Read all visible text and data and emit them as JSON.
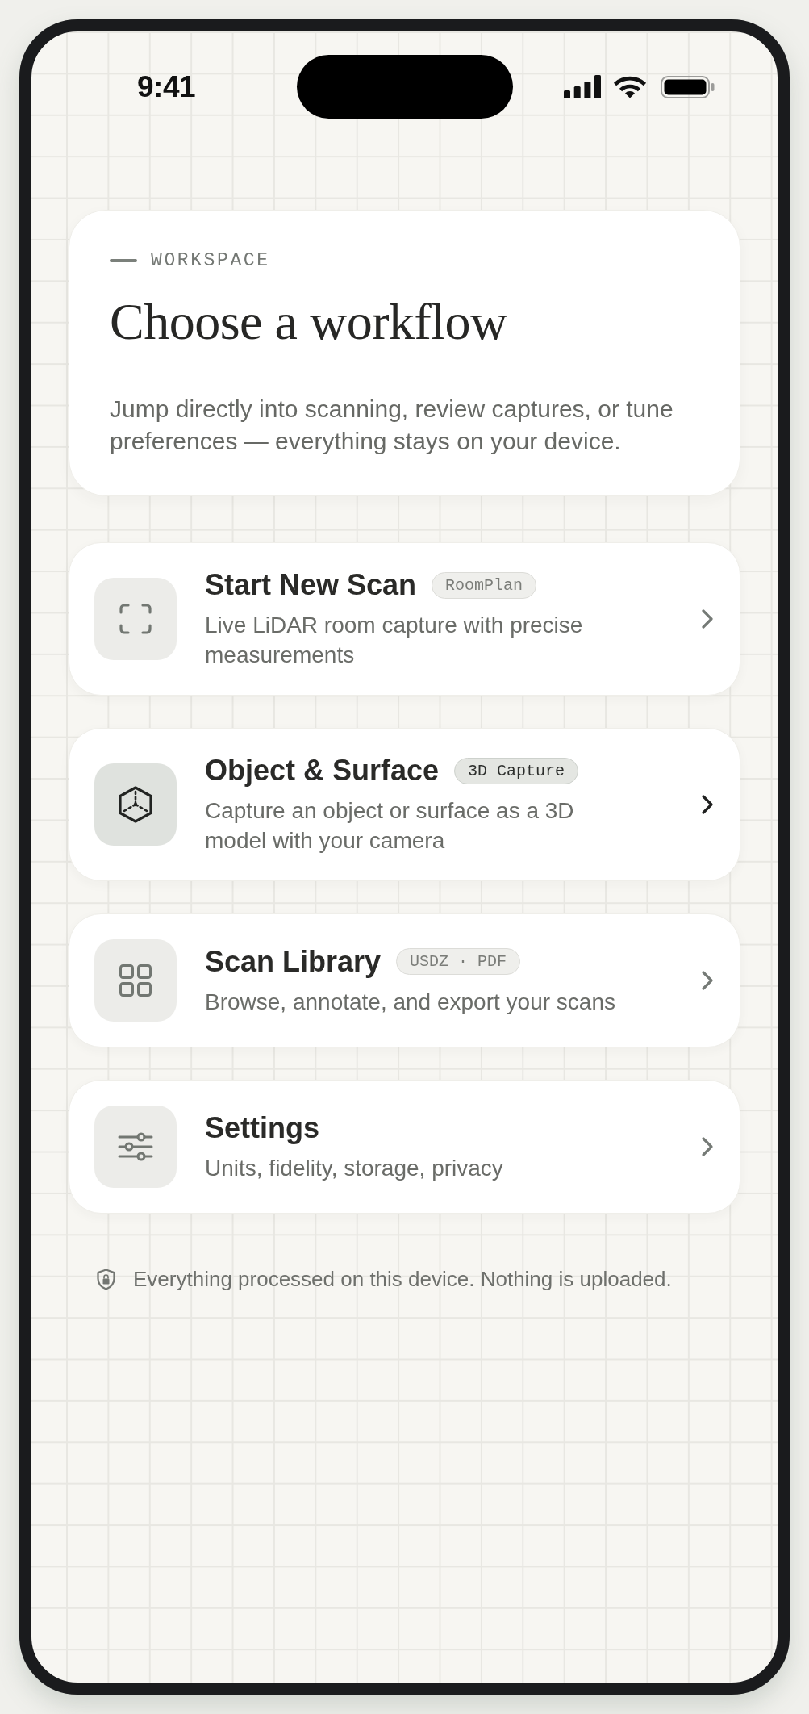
{
  "status_bar": {
    "time": "9:41"
  },
  "header": {
    "eyebrow": "WORKSPACE",
    "title": "Choose a workflow",
    "description": "Jump directly into scanning, review captures, or tune preferences — everything stays on your device."
  },
  "items": [
    {
      "kind": "scan",
      "title": "Start New Scan",
      "badge": "RoomPlan",
      "description": "Live LiDAR room capture with precise measurements",
      "selected": false
    },
    {
      "kind": "object",
      "title": "Object & Surface",
      "badge": "3D Capture",
      "description": "Capture an object or surface as a 3D model with your camera",
      "selected": true
    },
    {
      "kind": "library",
      "title": "Scan Library",
      "badge": "USDZ · PDF",
      "description": "Browse, annotate, and export your scans",
      "selected": false
    },
    {
      "kind": "settings",
      "title": "Settings",
      "description": "Units, fidelity, storage, privacy",
      "selected": false
    }
  ],
  "footer": {
    "note": "Everything processed on this device. Nothing is uploaded."
  }
}
